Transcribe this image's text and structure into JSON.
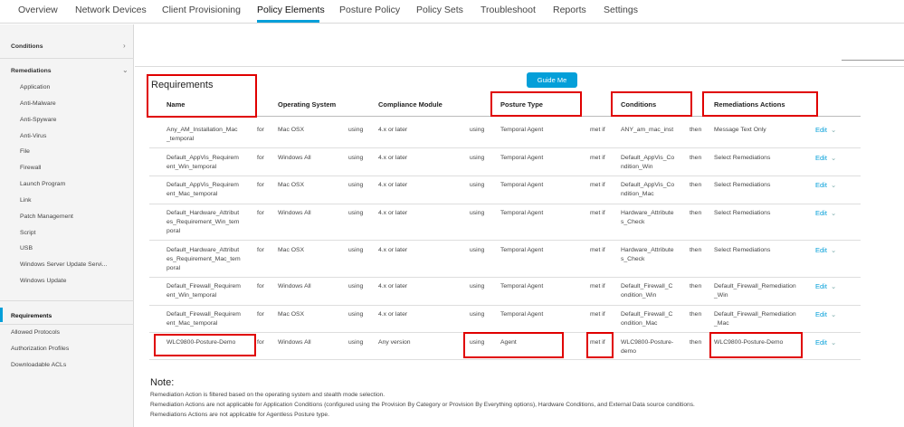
{
  "topnav": {
    "tabs": [
      "Overview",
      "Network Devices",
      "Client Provisioning",
      "Policy Elements",
      "Posture Policy",
      "Policy Sets",
      "Troubleshoot",
      "Reports",
      "Settings"
    ],
    "active_tab": "Policy Elements"
  },
  "sidebar": {
    "conditions": "Conditions",
    "remediations": "Remediations",
    "remediation_items": [
      "Application",
      "Anti-Malware",
      "Anti-Spyware",
      "Anti-Virus",
      "File",
      "Firewall",
      "Launch Program",
      "Link",
      "Patch Management",
      "Script",
      "USB",
      "Windows Server Update Servi...",
      "Windows Update"
    ],
    "requirements": "Requirements",
    "other_items": [
      "Allowed Protocols",
      "Authorization Profiles",
      "Downloadable ACLs"
    ]
  },
  "main": {
    "guide_me": "Guide Me",
    "title": "Requirements",
    "columns": [
      "Name",
      "Operating System",
      "Compliance Module",
      "Posture Type",
      "Conditions",
      "Remediations Actions"
    ],
    "rows": [
      {
        "name": [
          "Any_AM_Installation_Mac",
          "_temporal"
        ],
        "for": "for",
        "os": "Mac OSX",
        "using1": "using",
        "module": "4.x or later",
        "using2": "using",
        "posture": "Temporal Agent",
        "metif": "met if",
        "cond": [
          "ANY_am_mac_inst"
        ],
        "then": "then",
        "rem": [
          "Message Text Only"
        ],
        "edit": "Edit"
      },
      {
        "name": [
          "Default_AppVis_Requirem",
          "ent_Win_temporal"
        ],
        "for": "for",
        "os": "Windows All",
        "using1": "using",
        "module": "4.x or later",
        "using2": "using",
        "posture": "Temporal Agent",
        "metif": "met if",
        "cond": [
          "Default_AppVis_Co",
          "ndition_Win"
        ],
        "then": "then",
        "rem": [
          "Select Remediations"
        ],
        "edit": "Edit"
      },
      {
        "name": [
          "Default_AppVis_Requirem",
          "ent_Mac_temporal"
        ],
        "for": "for",
        "os": "Mac OSX",
        "using1": "using",
        "module": "4.x or later",
        "using2": "using",
        "posture": "Temporal Agent",
        "metif": "met if",
        "cond": [
          "Default_AppVis_Co",
          "ndition_Mac"
        ],
        "then": "then",
        "rem": [
          "Select Remediations"
        ],
        "edit": "Edit"
      },
      {
        "name": [
          "Default_Hardware_Attribut",
          "es_Requirement_Win_tem",
          "poral"
        ],
        "for": "for",
        "os": "Windows All",
        "using1": "using",
        "module": "4.x or later",
        "using2": "using",
        "posture": "Temporal Agent",
        "metif": "met if",
        "cond": [
          "Hardware_Attribute",
          "s_Check"
        ],
        "then": "then",
        "rem": [
          "Select Remediations"
        ],
        "edit": "Edit"
      },
      {
        "name": [
          "Default_Hardware_Attribut",
          "es_Requirement_Mac_tem",
          "poral"
        ],
        "for": "for",
        "os": "Mac OSX",
        "using1": "using",
        "module": "4.x or later",
        "using2": "using",
        "posture": "Temporal Agent",
        "metif": "met if",
        "cond": [
          "Hardware_Attribute",
          "s_Check"
        ],
        "then": "then",
        "rem": [
          "Select Remediations"
        ],
        "edit": "Edit"
      },
      {
        "name": [
          "Default_Firewall_Requirem",
          "ent_Win_temporal"
        ],
        "for": "for",
        "os": "Windows All",
        "using1": "using",
        "module": "4.x or later",
        "using2": "using",
        "posture": "Temporal Agent",
        "metif": "met if",
        "cond": [
          "Default_Firewall_C",
          "ondition_Win"
        ],
        "then": "then",
        "rem": [
          "Default_Firewall_Remediation",
          "_Win"
        ],
        "edit": "Edit"
      },
      {
        "name": [
          "Default_Firewall_Requirem",
          "ent_Mac_temporal"
        ],
        "for": "for",
        "os": "Mac OSX",
        "using1": "using",
        "module": "4.x or later",
        "using2": "using",
        "posture": "Temporal Agent",
        "metif": "met if",
        "cond": [
          "Default_Firewall_C",
          "ondition_Mac"
        ],
        "then": "then",
        "rem": [
          "Default_Firewall_Remediation",
          "_Mac"
        ],
        "edit": "Edit"
      },
      {
        "name": [
          "WLC9800-Posture-Demo"
        ],
        "for": "for",
        "os": "Windows All",
        "using1": "using",
        "module": "Any version",
        "using2": "using",
        "posture": "Agent",
        "metif": "met if",
        "cond": [
          "WLC9800-Posture-",
          "demo"
        ],
        "then": "then",
        "rem": [
          "WLC9800-Posture-Demo"
        ],
        "edit": "Edit"
      }
    ],
    "note_title": "Note:",
    "notes": [
      "Remediation Action is filtered based on the operating system and stealth mode selection.",
      "Remediation Actions are not applicable for Application Conditions (configured using the Provision By Category or Provision By Everything options), Hardware Conditions, and External Data source conditions.",
      "Remediations Actions are not applicable for Agentless Posture type."
    ]
  },
  "colors": {
    "accent": "#049fd9",
    "highlight": "#e00000"
  }
}
